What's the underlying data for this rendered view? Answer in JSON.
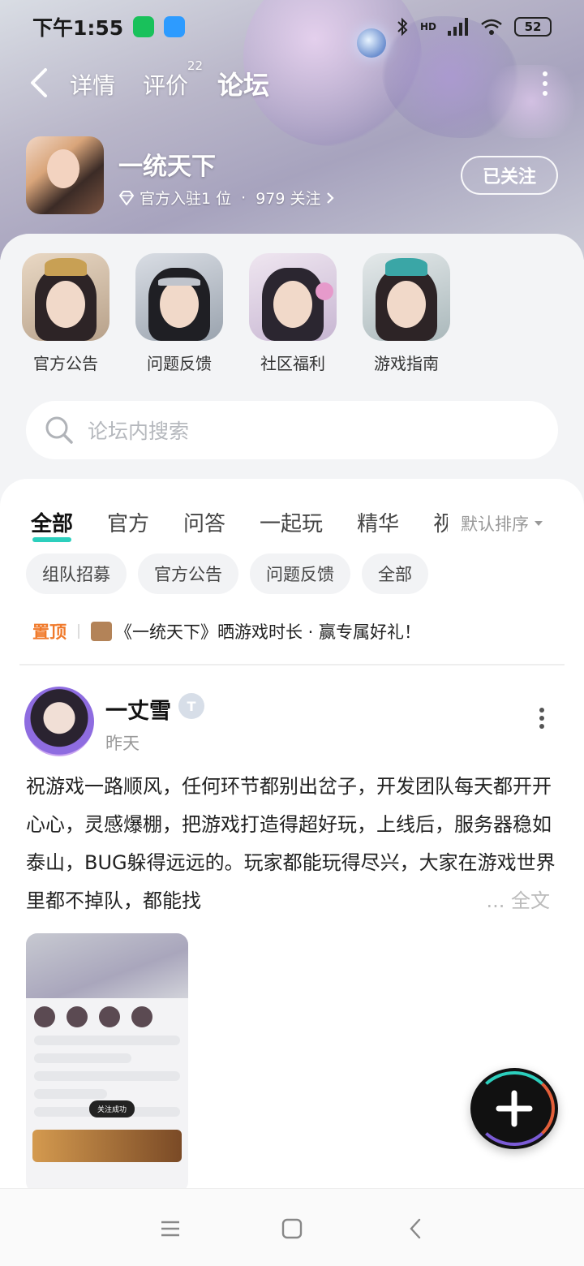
{
  "status_bar": {
    "time": "下午1:55",
    "apps": [
      "wechat-icon",
      "message-icon"
    ],
    "network": "HD",
    "battery": "52"
  },
  "top_nav": {
    "tabs": [
      {
        "label": "详情",
        "active": false
      },
      {
        "label": "评价",
        "badge": "22",
        "active": false
      },
      {
        "label": "论坛",
        "active": true
      }
    ]
  },
  "game": {
    "name": "一统天下",
    "official_count": "官方入驻1 位",
    "separator": "·",
    "followers": "979 关注",
    "follow_button": "已关注"
  },
  "channels": [
    {
      "label": "官方公告",
      "icon": "official-announcement-avatar"
    },
    {
      "label": "问题反馈",
      "icon": "feedback-avatar"
    },
    {
      "label": "社区福利",
      "icon": "community-welfare-avatar"
    },
    {
      "label": "游戏指南",
      "icon": "game-guide-avatar"
    }
  ],
  "search": {
    "placeholder": "论坛内搜索"
  },
  "filter_tabs": [
    {
      "label": "全部",
      "active": true
    },
    {
      "label": "官方"
    },
    {
      "label": "问答"
    },
    {
      "label": "一起玩"
    },
    {
      "label": "精华"
    },
    {
      "label": "视"
    }
  ],
  "sort": {
    "label": "默认排序"
  },
  "chips": [
    "组队招募",
    "官方公告",
    "问题反馈",
    "全部"
  ],
  "pinned": {
    "tag": "置顶",
    "title": "《一统天下》晒游戏时长 · 赢专属好礼！"
  },
  "post": {
    "username": "一丈雪",
    "badge": "T",
    "time": "昨天",
    "text": "祝游戏一路顺风，任何环节都别出岔子，开发团队每天都开开心心，灵感爆棚，把游戏打造得超好玩，上线后，服务器稳如泰山，BUG躲得远远的。玩家都能玩得尽兴，大家在游戏世界里都不掉队，都能找",
    "more": "... 全文",
    "thumb_toast": "关注成功"
  },
  "colors": {
    "accent": "#2ccfbd",
    "pinned": "#f07a2b"
  }
}
